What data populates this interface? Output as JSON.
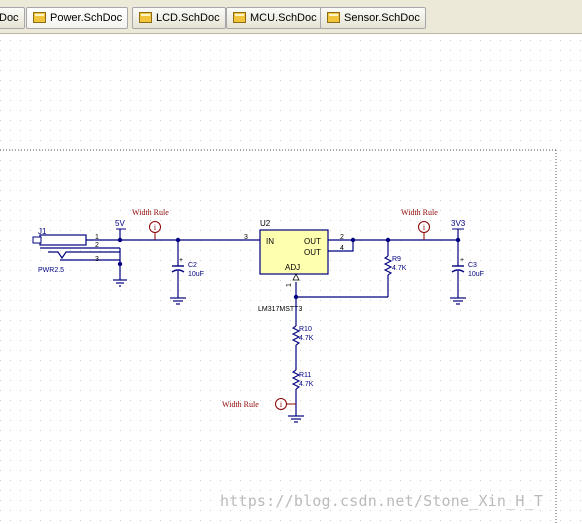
{
  "tabs": [
    {
      "label": "Doc",
      "active": false
    },
    {
      "label": "Power.SchDoc",
      "active": true
    },
    {
      "label": "LCD.SchDoc",
      "active": false
    },
    {
      "label": "MCU.SchDoc",
      "active": false
    },
    {
      "label": "Sensor.SchDoc",
      "active": false
    }
  ],
  "schematic": {
    "connector": {
      "designator": "J1",
      "comment": "PWR2.5",
      "pins": [
        "1",
        "2",
        "3"
      ]
    },
    "regulator": {
      "designator": "U2",
      "comment": "LM317MSTT3",
      "pin_in": "IN",
      "pin_out1": "OUT",
      "pin_out2": "OUT",
      "pin_adj": "ADJ",
      "pin_num_in": "3",
      "pin_num_out1": "2",
      "pin_num_out2": "4",
      "pin_num_adj": "1"
    },
    "net_5v": "5V",
    "net_3v3": "3V3",
    "c2": {
      "designator": "C2",
      "value": "10uF"
    },
    "c3": {
      "designator": "C3",
      "value": "10uF"
    },
    "r9": {
      "designator": "R9",
      "value": "4.7K"
    },
    "r10": {
      "designator": "R10",
      "value": "4.7K"
    },
    "r11": {
      "designator": "R11",
      "value": "4.7K"
    },
    "width_rule_label": "Width Rule",
    "directive_icon": "i",
    "polarity": "+"
  },
  "watermark": "https://blog.csdn.net/Stone_Xin_H_T",
  "colors": {
    "wire": "#000080",
    "directive": "#8b0000",
    "regulator_fill": "#ffffb0",
    "grid": "#d4d4d4",
    "tab_bar": "#ece9d8"
  }
}
